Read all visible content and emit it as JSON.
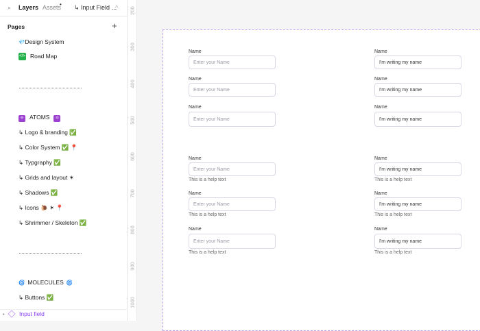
{
  "tabs": {
    "layers": "Layers",
    "assets": "Assets",
    "assets_dot": "•",
    "breadcrumb": "↳ Input Field ...",
    "chevron": "^"
  },
  "pages": {
    "title": "Pages",
    "add": "+"
  },
  "sidebar_items": [
    {
      "icon": "💎",
      "label": "Design System"
    },
    {
      "icon": "</>",
      "label": "Road Map"
    },
    {
      "icon": "⚛",
      "label": "ATOMS",
      "suffix": "⚛"
    },
    {
      "label": "↳ Logo & branding ✅"
    },
    {
      "label": "↳ Color System ✅ 📍"
    },
    {
      "label": "↳ Typgraphy ✅"
    },
    {
      "label": "↳ Grids and layout ✶"
    },
    {
      "label": "↳ Shadows ✅"
    },
    {
      "label": "↳ Icons 🐌 ✶ 📍"
    },
    {
      "label": "↳ Shrimmer / Skeleton ✅"
    },
    {
      "icon": "🌀",
      "label": "MOLECULES",
      "suffix": "🌀"
    },
    {
      "label": "↳ Buttons ✅"
    }
  ],
  "layer": {
    "label": "Input field"
  },
  "ruler": [
    "200",
    "300",
    "400",
    "500",
    "600",
    "700",
    "800",
    "900",
    "1000"
  ],
  "form": {
    "label": "Name",
    "placeholder": "Enter your Name",
    "value": "I'm writing my name",
    "help": "This is a help text"
  },
  "colors": {
    "accent": "#8a3ffc",
    "frame": "#b9a0e6"
  }
}
